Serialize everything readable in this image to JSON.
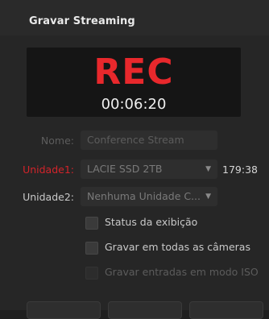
{
  "window": {
    "title": "Gravar Streaming"
  },
  "recorder": {
    "status": "REC",
    "timecode": "00:06:20"
  },
  "form": {
    "name_label": "Nome:",
    "name_value": "Conference Stream",
    "disk1_label": "Unidade1:",
    "disk1_value": "LACIE SSD 2TB",
    "disk1_remaining": "179:38",
    "disk2_label": "Unidade2:",
    "disk2_value": "Nenhuma Unidade C..."
  },
  "options": {
    "status_display": "Status da exibição",
    "record_all_cameras": "Gravar em todas as câmeras",
    "record_iso_inputs": "Gravar entradas em modo ISO"
  },
  "colors": {
    "rec_red": "#e8282c",
    "error_label": "#d3232a"
  }
}
